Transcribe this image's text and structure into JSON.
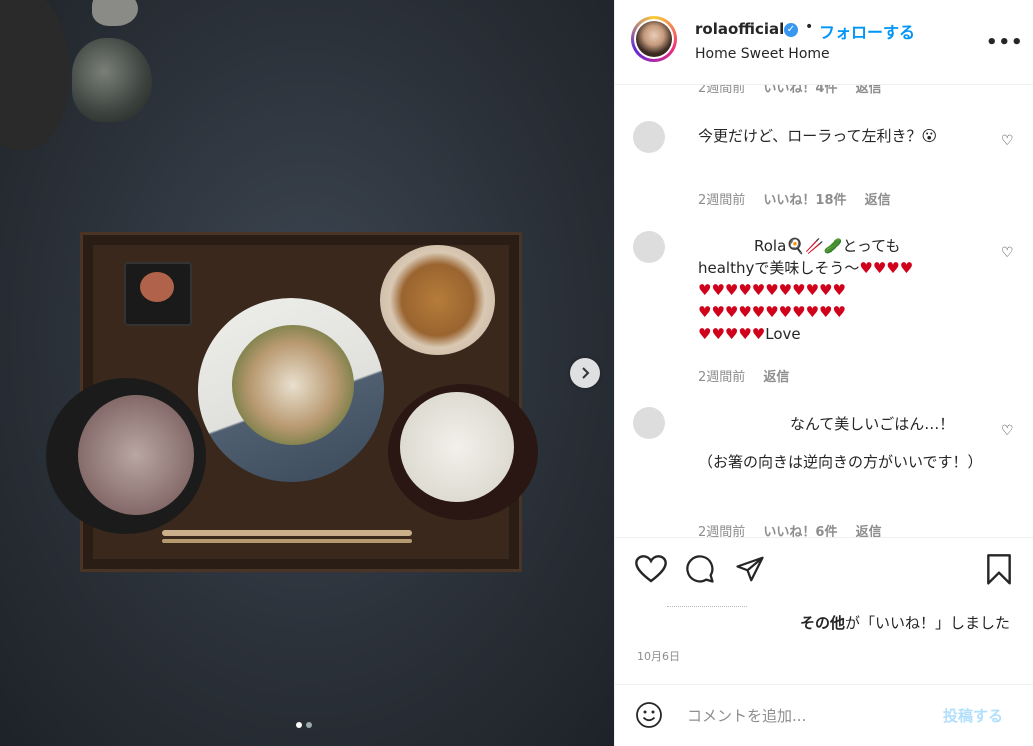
{
  "post": {
    "username": "rolaofficial",
    "verified_mark": "✓",
    "bullet": "•",
    "follow_label": "フォローする",
    "location": "Home Sweet Home",
    "more_label": "•••",
    "carousel_next": "›"
  },
  "comments": [
    {
      "text": "今更だけど、ローラって左利き？😮",
      "time": "2週間前",
      "likes": "いいね！18件",
      "reply": "返信"
    },
    {
      "text_line1": "Rola🍳🥢🥒とっても",
      "text_line2": "healthyで美味しそう〜",
      "hearts_line1": "♥♥♥♥",
      "hearts_line2": "♥♥♥♥♥♥♥♥♥♥♥",
      "hearts_line3": "♥♥♥♥♥♥♥♥♥♥♥",
      "hearts_line4": "♥♥♥♥♥",
      "love": "Love",
      "time": "2週間前",
      "reply": "返信"
    },
    {
      "text_line1": "なんて美しいごはん…！",
      "text_line2": "（お箸の向きは逆向きの方がいいです！）",
      "time": "2週間前",
      "likes": "いいね！6件",
      "reply": "返信"
    }
  ],
  "partial_top": {
    "time": "2週間前",
    "likes": "いいね！4件",
    "reply": "返信"
  },
  "likes_summary": {
    "bold": "その他",
    "rest": "が「いいね！」しました"
  },
  "date": "10月6日",
  "add_comment": {
    "placeholder": "コメントを追加...",
    "post_label": "投稿する"
  },
  "colors": {
    "accent": "#0095f6",
    "post_disabled": "#b2dffc",
    "verified": "#3897f0"
  }
}
